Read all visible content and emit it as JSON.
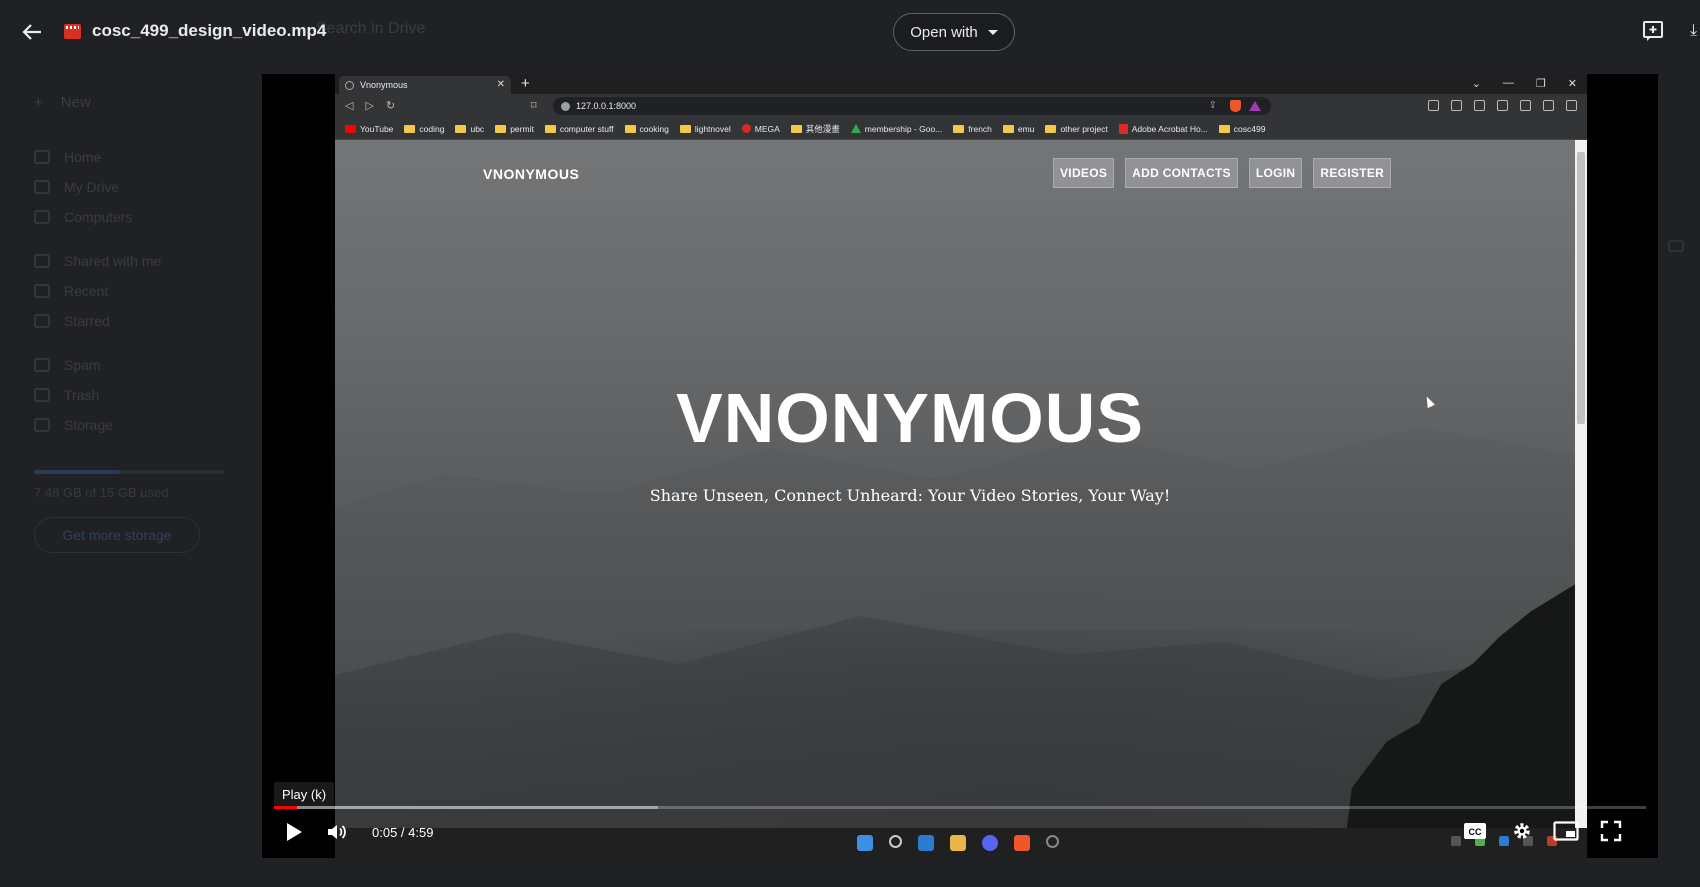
{
  "header": {
    "file_title": "cosc_499_design_video.mp4",
    "open_with_label": "Open with"
  },
  "drive_background": {
    "search_placeholder": "Search in Drive",
    "new_label": "New",
    "nav": [
      "Home",
      "My Drive",
      "Computers",
      "Shared with me",
      "Recent",
      "Starred",
      "Spam",
      "Trash",
      "Storage"
    ],
    "storage_text": "7.48 GB of 15 GB used",
    "get_storage_label": "Get more storage"
  },
  "recording": {
    "browser": {
      "tab_title": "Vnonymous",
      "url": "127.0.0.1:8000",
      "bookmarks": [
        {
          "label": "YouTube",
          "icon": "youtube-icon"
        },
        {
          "label": "coding",
          "icon": "folder-icon"
        },
        {
          "label": "ubc",
          "icon": "folder-icon"
        },
        {
          "label": "permit",
          "icon": "folder-icon"
        },
        {
          "label": "computer stuff",
          "icon": "folder-icon"
        },
        {
          "label": "cooking",
          "icon": "folder-icon"
        },
        {
          "label": "lightnovel",
          "icon": "folder-icon"
        },
        {
          "label": "MEGA",
          "icon": "mega-icon"
        },
        {
          "label": "其他漫畫",
          "icon": "folder-icon"
        },
        {
          "label": "membership - Goo...",
          "icon": "google-drive-icon"
        },
        {
          "label": "french",
          "icon": "folder-icon"
        },
        {
          "label": "emu",
          "icon": "folder-icon"
        },
        {
          "label": "other project",
          "icon": "folder-icon"
        },
        {
          "label": "Adobe Acrobat Ho...",
          "icon": "pdf-icon"
        },
        {
          "label": "cosc499",
          "icon": "folder-icon"
        }
      ]
    },
    "site": {
      "logo": "VNONYMOUS",
      "nav": [
        "VIDEOS",
        "ADD CONTACTS",
        "LOGIN",
        "REGISTER"
      ],
      "hero_title": "VNONYMOUS",
      "hero_subtitle": "Share Unseen, Connect Unheard: Your Video Stories, Your Way!"
    }
  },
  "player": {
    "tooltip": "Play (k)",
    "current_time": "0:05",
    "duration": "4:59",
    "time_display": "0:05 / 4:59",
    "played_fraction": 0.017,
    "buffered_fraction": 0.28,
    "colors": {
      "progress": "#ff0000",
      "accent_brave": "#f0562a"
    }
  }
}
